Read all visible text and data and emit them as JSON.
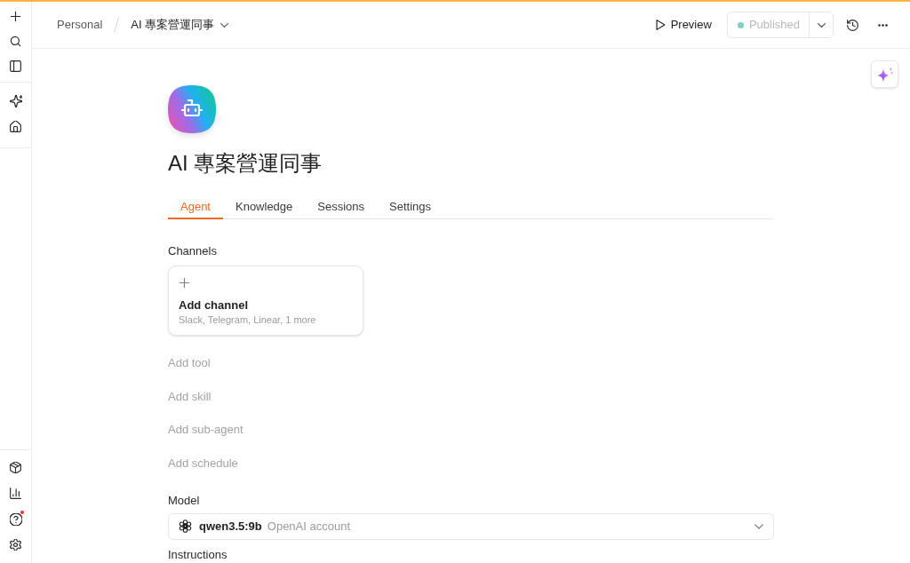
{
  "top_bar": {
    "breadcrumbs": [
      {
        "label": "Personal",
        "current": false,
        "dropdown": false
      },
      {
        "label": "AI 專案營運同事",
        "current": true,
        "dropdown": true
      }
    ],
    "preview_button": {
      "label": "Preview"
    },
    "publish_button": {
      "label": "Published",
      "disabled": true
    }
  },
  "sidebar": {
    "help_notification": true
  },
  "agent": {
    "name": "AI 專案營運同事"
  },
  "tabs": [
    {
      "label": "Agent",
      "selected": true
    },
    {
      "label": "Knowledge",
      "selected": false
    },
    {
      "label": "Sessions",
      "selected": false
    },
    {
      "label": "Settings",
      "selected": false
    }
  ],
  "channels": {
    "label": "Channels",
    "card": {
      "title": "Add channel",
      "subtitle": "Slack, Telegram, Linear, 1 more"
    }
  },
  "add_links": [
    "Add tool",
    "Add skill",
    "Add sub-agent",
    "Add schedule"
  ],
  "model": {
    "label": "Model",
    "name": "qwen3.5:9b",
    "provider": "OpenAI account"
  },
  "instructions": {
    "label": "Instructions"
  }
}
